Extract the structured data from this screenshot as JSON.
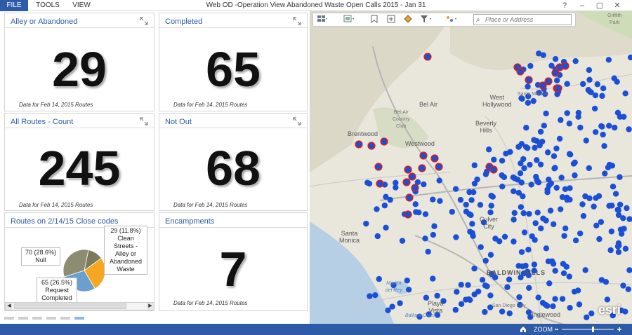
{
  "titlebar": {
    "tabs": [
      {
        "label": "FILE",
        "active": true
      },
      {
        "label": "TOOLS",
        "active": false
      },
      {
        "label": "VIEW",
        "active": false
      }
    ],
    "window_title": "Web OD -Operation View Abandoned Waste Open Calls 2015 - Jan 31",
    "help": "?",
    "minimize": "–",
    "restore": "▢",
    "close": "✕"
  },
  "widgets": {
    "alley": {
      "title": "Alley or Abandoned",
      "value": "29",
      "footer": "Data for Feb 14, 2015 Routes"
    },
    "completed": {
      "title": "Completed",
      "value": "65",
      "footer": "Data for Feb 14, 2015 Routes"
    },
    "all_routes": {
      "title": "All Routes - Count",
      "value": "245",
      "footer": "Data for Feb 14, 2015 Routes"
    },
    "not_out": {
      "title": "Not Out",
      "value": "68",
      "footer": "Data for Feb 14, 2015 Routes"
    },
    "encampments": {
      "title": "Encampments",
      "value": "7",
      "footer": "Data for Feb 14, 2015 Routes"
    }
  },
  "pie_widget": {
    "title": "Routes on 2/14/15 Close codes",
    "labels": {
      "top": "29 (11.8%)",
      "clean": [
        "Clean Streets -",
        "Alley or",
        "Abandoned",
        "Waste"
      ],
      "null": [
        "70 (28.6%)",
        "Null"
      ],
      "request": [
        "65 (26.5%)",
        "Request",
        "Completed"
      ]
    },
    "scroll_left": "◀",
    "scroll_right": "▶"
  },
  "chart_data": {
    "type": "pie",
    "title": "Routes on 2/14/15 Close codes",
    "slices": [
      {
        "label": "Clean Streets - Alley or Abandoned Waste",
        "value": 29,
        "percent": 11.8,
        "color": "#7a7a5c"
      },
      {
        "label": "Request Completed",
        "value": 65,
        "percent": 26.5,
        "color": "#f5a623"
      },
      {
        "label": "Null",
        "value": 70,
        "percent": 28.6,
        "color": "#6a9fd0"
      },
      {
        "label": "",
        "value": 81,
        "percent": 33.1,
        "color": "#8c8c70"
      }
    ]
  },
  "map": {
    "search_placeholder": "Place or Address",
    "labels": {
      "bel_air": "Bel Air",
      "bel_air_cc": [
        "Bel-Air",
        "Country",
        "Club"
      ],
      "west_hollywood": [
        "West",
        "Hollywood"
      ],
      "beverly_hills": [
        "Beverly",
        "Hills"
      ],
      "brentwood": "Brentwood",
      "westwood": "Westwood",
      "santa_monica": [
        "Santa",
        "Monica"
      ],
      "culver_city": [
        "Culver",
        "City"
      ],
      "marina": [
        "Marina",
        "del Rey"
      ],
      "playa_vista": [
        "Playa",
        "Vista"
      ],
      "baldwin_hills": "BALDWIN HILLS",
      "inglewood": "Inglewood",
      "griffith": [
        "Griffith",
        "Park"
      ],
      "santa_monica_blvd": "Santa Monica",
      "san_diego_fwy": "San Diego Fwy",
      "ballona": "Ballona Creek"
    },
    "zoom_label": "ZOOM",
    "esri": "esri",
    "colors": {
      "point_fill": "#1a4fd6",
      "point_outline_selected": "#d62020"
    }
  }
}
